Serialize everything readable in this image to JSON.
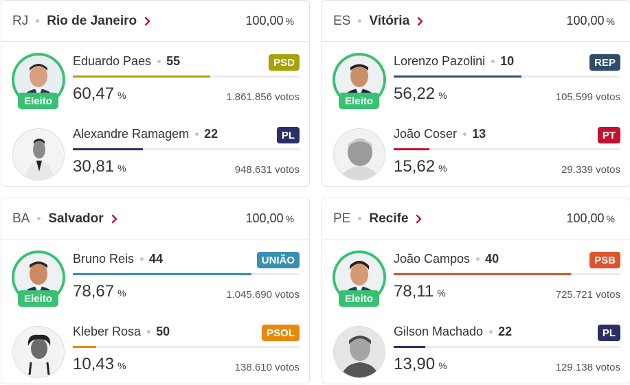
{
  "cards": [
    {
      "state": "RJ",
      "city": "Rio de Janeiro",
      "counted": "100,00",
      "pct_unit": "%",
      "candidates": [
        {
          "name": "Eduardo Paes",
          "number": "55",
          "party": "PSD",
          "party_color": "#a5a20a",
          "percent": "60,47",
          "percent_value": 60.47,
          "votes": "1.861.856 votos",
          "elected": true,
          "badge": "Eleito",
          "bar_color": "#a5a20a"
        },
        {
          "name": "Alexandre Ramagem",
          "number": "22",
          "party": "PL",
          "party_color": "#2b2f66",
          "percent": "30,81",
          "percent_value": 30.81,
          "votes": "948.631 votos",
          "elected": false,
          "bar_color": "#2b2f66"
        }
      ]
    },
    {
      "state": "ES",
      "city": "Vitória",
      "counted": "100,00",
      "pct_unit": "%",
      "candidates": [
        {
          "name": "Lorenzo Pazolini",
          "number": "10",
          "party": "REP",
          "party_color": "#2f4d6b",
          "percent": "56,22",
          "percent_value": 56.22,
          "votes": "105.599 votos",
          "elected": true,
          "badge": "Eleito",
          "bar_color": "#2f4d6b"
        },
        {
          "name": "João Coser",
          "number": "13",
          "party": "PT",
          "party_color": "#c8102e",
          "percent": "15,62",
          "percent_value": 15.62,
          "votes": "29.339 votos",
          "elected": false,
          "bar_color": "#c8102e"
        }
      ]
    },
    {
      "state": "BA",
      "city": "Salvador",
      "counted": "100,00",
      "pct_unit": "%",
      "candidates": [
        {
          "name": "Bruno Reis",
          "number": "44",
          "party": "UNIÃO",
          "party_color": "#3a8fb0",
          "percent": "78,67",
          "percent_value": 78.67,
          "votes": "1.045.690 votos",
          "elected": true,
          "badge": "Eleito",
          "bar_color": "#3a8fb0"
        },
        {
          "name": "Kleber Rosa",
          "number": "50",
          "party": "PSOL",
          "party_color": "#e8890c",
          "percent": "10,43",
          "percent_value": 10.43,
          "votes": "138.610 votos",
          "elected": false,
          "bar_color": "#e8890c"
        }
      ]
    },
    {
      "state": "PE",
      "city": "Recife",
      "counted": "100,00",
      "pct_unit": "%",
      "candidates": [
        {
          "name": "João Campos",
          "number": "40",
          "party": "PSB",
          "party_color": "#e0522a",
          "percent": "78,11",
          "percent_value": 78.11,
          "votes": "725.721 votos",
          "elected": true,
          "badge": "Eleito",
          "bar_color": "#e0522a"
        },
        {
          "name": "Gilson Machado",
          "number": "22",
          "party": "PL",
          "party_color": "#2b2f66",
          "percent": "13,90",
          "percent_value": 13.9,
          "votes": "129.138 votos",
          "elected": false,
          "bar_color": "#2b2f66"
        }
      ]
    }
  ],
  "icons": {
    "chevron": "chevron-right-icon",
    "avatar": "person-photo"
  },
  "colors": {
    "elected": "#38c172",
    "chevron": "#c8102e"
  }
}
